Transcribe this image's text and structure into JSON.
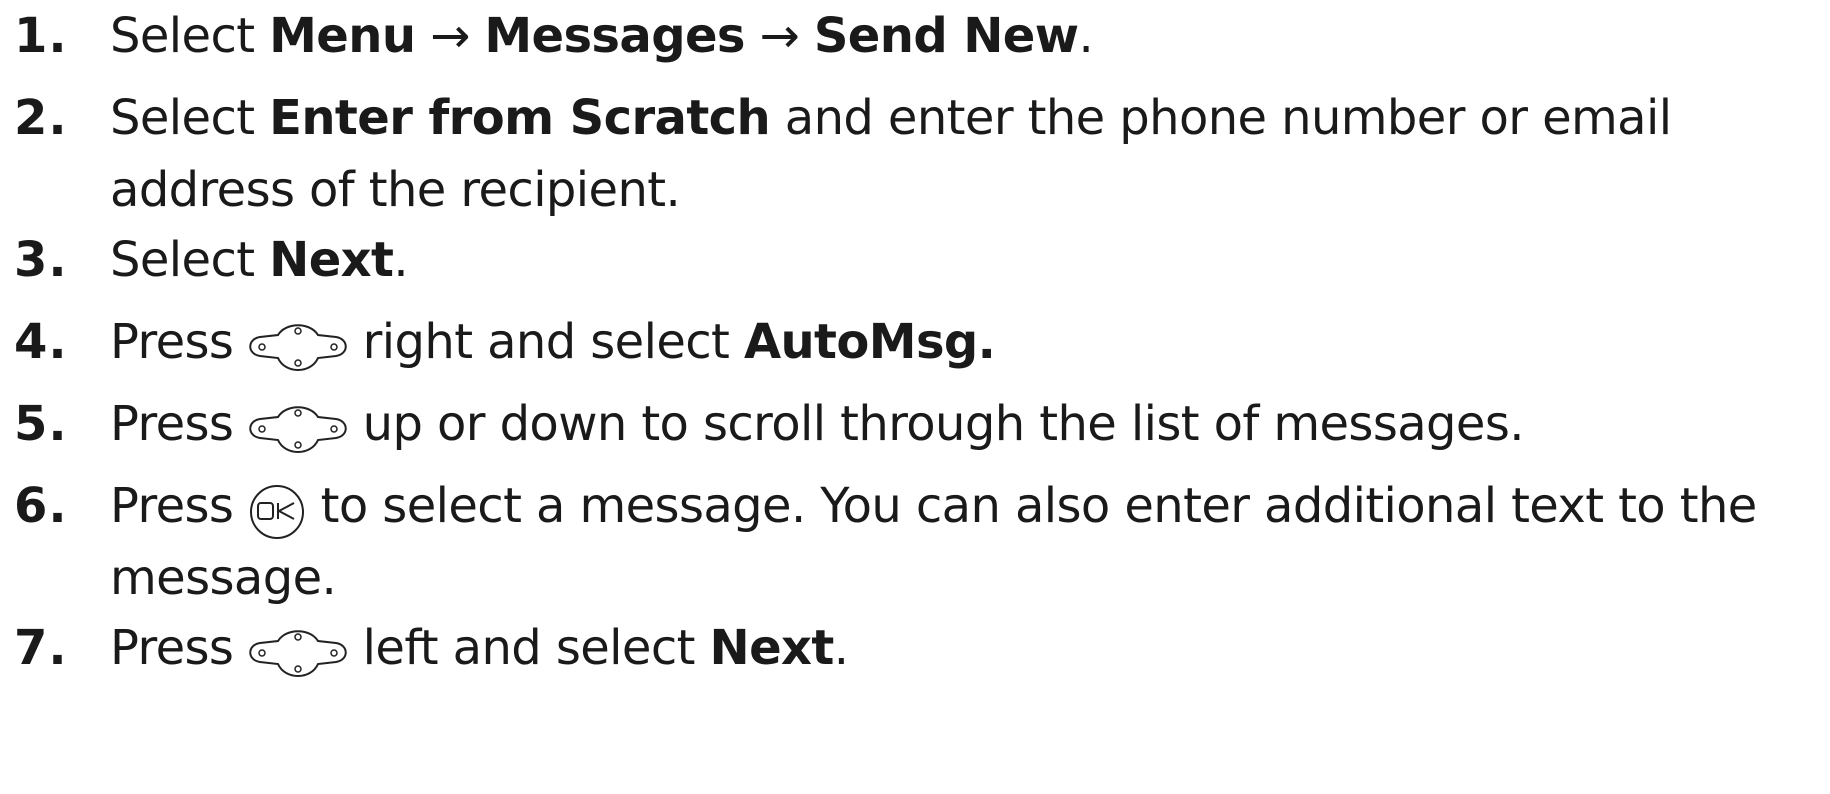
{
  "steps": [
    {
      "number": "1.",
      "parts": [
        {
          "t": "Select "
        },
        {
          "b": "Menu"
        },
        {
          "t": " → "
        },
        {
          "b": "Messages"
        },
        {
          "t": " → "
        },
        {
          "b": "Send New"
        },
        {
          "t": "."
        }
      ]
    },
    {
      "number": "2.",
      "parts": [
        {
          "t": "Select "
        },
        {
          "b": "Enter from Scratch"
        },
        {
          "t": " and enter the phone number or email address of the recipient."
        }
      ]
    },
    {
      "number": "3.",
      "parts": [
        {
          "t": "Select "
        },
        {
          "b": "Next"
        },
        {
          "t": "."
        }
      ]
    },
    {
      "number": "4.",
      "parts": [
        {
          "t": "Press "
        },
        {
          "icon": "nav-key-icon"
        },
        {
          "t": " right and select "
        },
        {
          "b": "AutoMsg."
        }
      ]
    },
    {
      "number": "5.",
      "parts": [
        {
          "t": "Press "
        },
        {
          "icon": "nav-key-icon"
        },
        {
          "t": " up or down to scroll through the list of messages."
        }
      ]
    },
    {
      "number": "6.",
      "parts": [
        {
          "t": "Press "
        },
        {
          "icon": "ok-key-icon"
        },
        {
          "t": " to select a message. You can also enter additional text to the message."
        }
      ]
    },
    {
      "number": "7.",
      "parts": [
        {
          "t": "Press "
        },
        {
          "icon": "nav-key-icon"
        },
        {
          "t": " left and select "
        },
        {
          "b": "Next"
        },
        {
          "t": "."
        }
      ]
    }
  ]
}
